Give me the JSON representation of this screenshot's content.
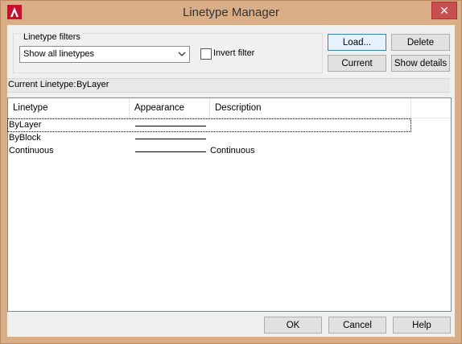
{
  "window": {
    "title": "Linetype Manager",
    "close_glyph": "✕",
    "app_icon": "autocad-logo-icon"
  },
  "filters": {
    "legend": "Linetype filters",
    "select_value": "Show all linetypes",
    "invert_label": "Invert filter",
    "invert_checked": false
  },
  "buttons": {
    "load": "Load...",
    "delete": "Delete",
    "current": "Current",
    "show_details": "Show details",
    "ok": "OK",
    "cancel": "Cancel",
    "help": "Help"
  },
  "current_linetype": {
    "label": "Current Linetype:",
    "value": "ByLayer"
  },
  "table": {
    "columns": [
      "Linetype",
      "Appearance",
      "Description"
    ],
    "rows": [
      {
        "linetype": "ByLayer",
        "description": ""
      },
      {
        "linetype": "ByBlock",
        "description": ""
      },
      {
        "linetype": "Continuous",
        "description": "Continuous"
      }
    ]
  }
}
